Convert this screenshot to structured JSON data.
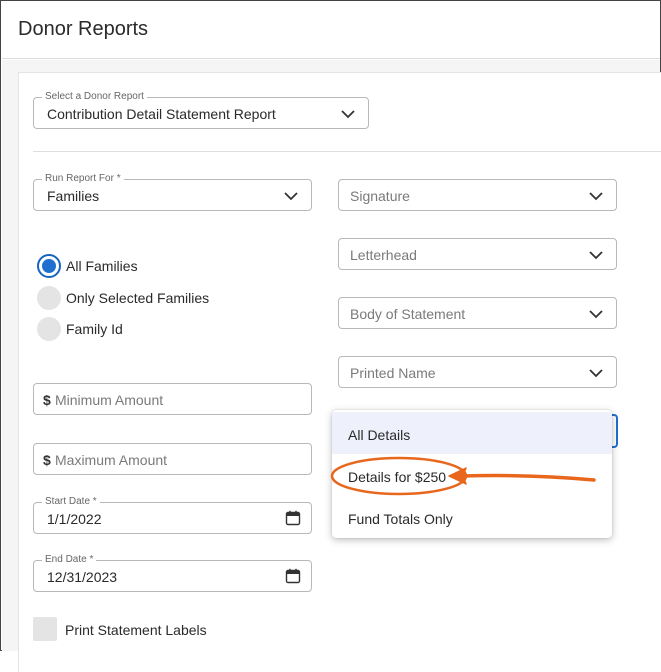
{
  "page": {
    "title": "Donor Reports"
  },
  "report_select": {
    "label": "Select a Donor Report",
    "value": "Contribution Detail Statement Report"
  },
  "run_for": {
    "label": "Run Report For *",
    "value": "Families"
  },
  "radios": [
    {
      "label": "All Families",
      "selected": true
    },
    {
      "label": "Only Selected Families",
      "selected": false
    },
    {
      "label": "Family Id",
      "selected": false
    }
  ],
  "amounts": {
    "currency_symbol": "$",
    "min_placeholder": "Minimum Amount",
    "max_placeholder": "Maximum Amount"
  },
  "start_date": {
    "label": "Start Date *",
    "value": "1/1/2022"
  },
  "end_date": {
    "label": "End Date *",
    "value": "12/31/2023"
  },
  "print_labels": {
    "label": "Print Statement Labels"
  },
  "right_selects": {
    "signature": "Signature",
    "letterhead": "Letterhead",
    "body": "Body of Statement",
    "printed_name": "Printed Name"
  },
  "detail_menu": {
    "items": [
      "All Details",
      "Details for $250",
      "Fund Totals Only"
    ]
  },
  "colors": {
    "accent": "#1e6fd0",
    "annotation": "#e8671c",
    "highlight": "#eef1fb"
  }
}
